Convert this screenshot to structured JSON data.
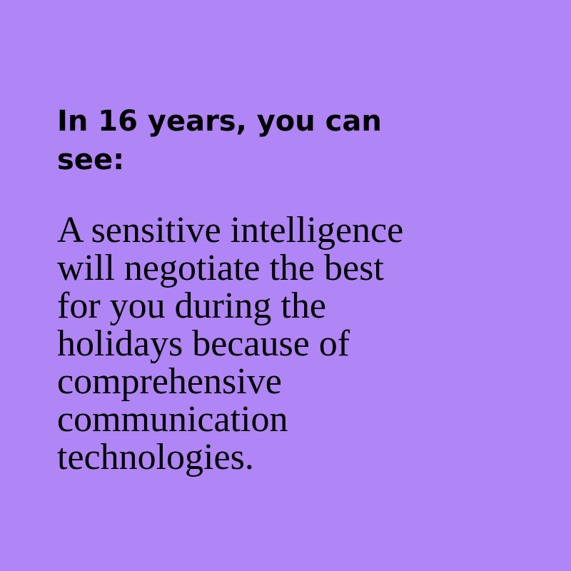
{
  "background_color": "#b085f5",
  "text_color": "#000000",
  "heading": {
    "lines": [
      "In 16 years, you can",
      "see:"
    ]
  },
  "body": {
    "lines": [
      "A sensitive intelligence",
      "will negotiate the best",
      "for you during the",
      "holidays because of",
      "comprehensive",
      "communication",
      "technologies."
    ]
  }
}
